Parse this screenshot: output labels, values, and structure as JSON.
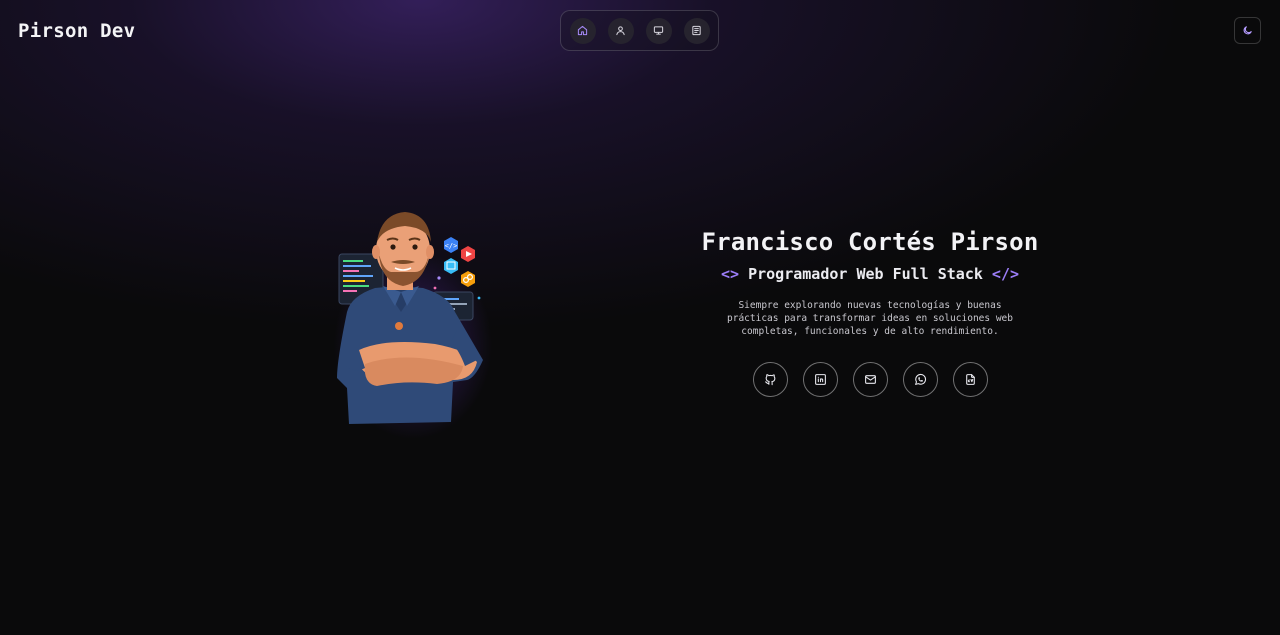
{
  "brand": {
    "name": "Pirson Dev"
  },
  "nav": {
    "items": [
      {
        "icon": "home-icon",
        "active": true
      },
      {
        "icon": "user-icon",
        "active": false
      },
      {
        "icon": "projects-icon",
        "active": false
      },
      {
        "icon": "document-icon",
        "active": false
      }
    ]
  },
  "theme_toggle": {
    "icon": "moon-icon"
  },
  "hero": {
    "name": "Francisco Cortés Pirson",
    "role_open": "<>",
    "role": "Programador Web Full Stack",
    "role_close": "</>",
    "description": "Siempre explorando nuevas tecnologías y buenas prácticas para transformar ideas en soluciones web completas, funcionales y de alto rendimiento."
  },
  "social": [
    {
      "icon": "github-icon"
    },
    {
      "icon": "linkedin-icon"
    },
    {
      "icon": "mail-icon"
    },
    {
      "icon": "whatsapp-icon"
    },
    {
      "icon": "cv-file-icon"
    }
  ],
  "colors": {
    "accent": "#9b7df7",
    "background": "#0a0a0b"
  }
}
